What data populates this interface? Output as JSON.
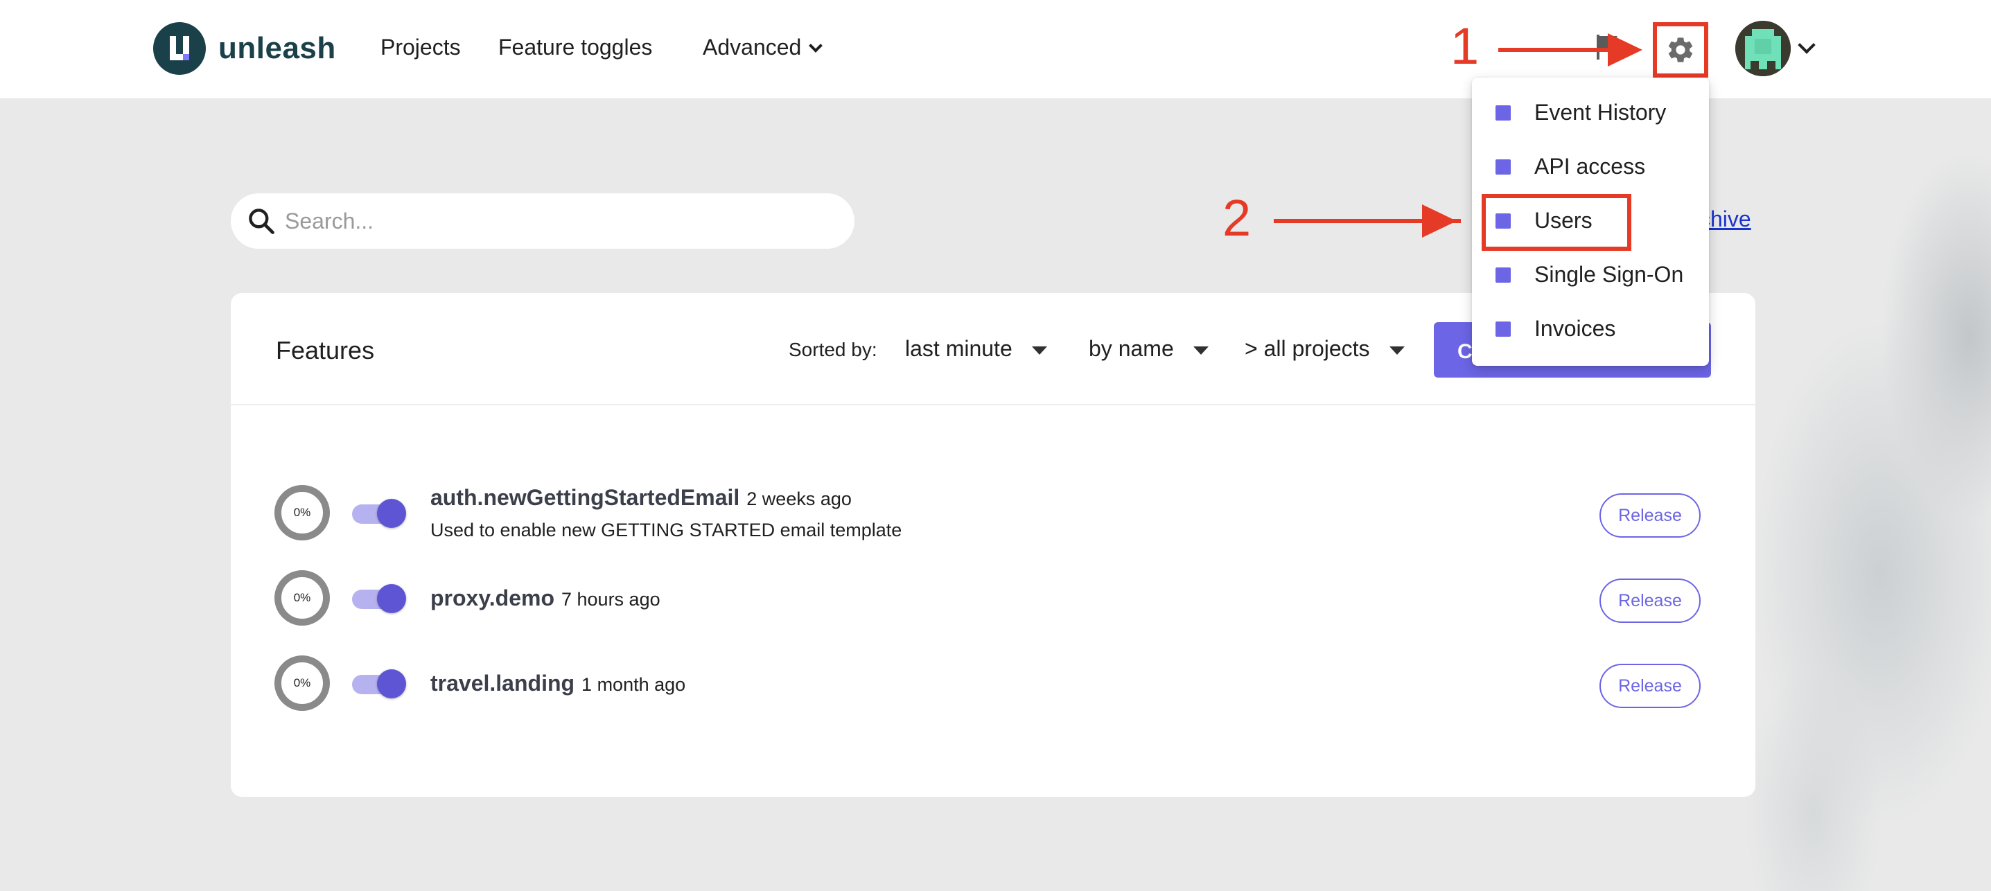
{
  "header": {
    "logo_text": "unleash",
    "nav": {
      "projects": "Projects",
      "feature_toggles": "Feature toggles",
      "advanced": "Advanced"
    }
  },
  "annotations": {
    "step1": "1",
    "step2": "2"
  },
  "search": {
    "placeholder": "Search..."
  },
  "archive_link": "Archive",
  "features": {
    "title": "Features",
    "sorted_by_label": "Sorted by:",
    "sort_time": "last minute",
    "sort_order": "by name",
    "sort_project": "> all projects",
    "create_button": "Create feature toggle",
    "rows": [
      {
        "name": "auth.newGettingStartedEmail",
        "time": "2 weeks ago",
        "description": "Used to enable new GETTING STARTED email template",
        "percent": "0%",
        "enabled": true,
        "type": "Release"
      },
      {
        "name": "proxy.demo",
        "time": "7 hours ago",
        "description": "",
        "percent": "0%",
        "enabled": true,
        "type": "Release"
      },
      {
        "name": "travel.landing",
        "time": "1 month ago",
        "description": "",
        "percent": "0%",
        "enabled": true,
        "type": "Release"
      }
    ]
  },
  "settings_menu": {
    "items": [
      {
        "label": "Event History"
      },
      {
        "label": "API access"
      },
      {
        "label": "Users"
      },
      {
        "label": "Single Sign-On"
      },
      {
        "label": "Invoices"
      }
    ]
  },
  "colors": {
    "brand": "#1a4049",
    "accent": "#6c65e5",
    "annotation": "#e53a26",
    "background": "#e9e9e9"
  },
  "icons": [
    "search-icon",
    "gear-icon",
    "flag-icon",
    "chevron-down-icon",
    "avatar"
  ]
}
